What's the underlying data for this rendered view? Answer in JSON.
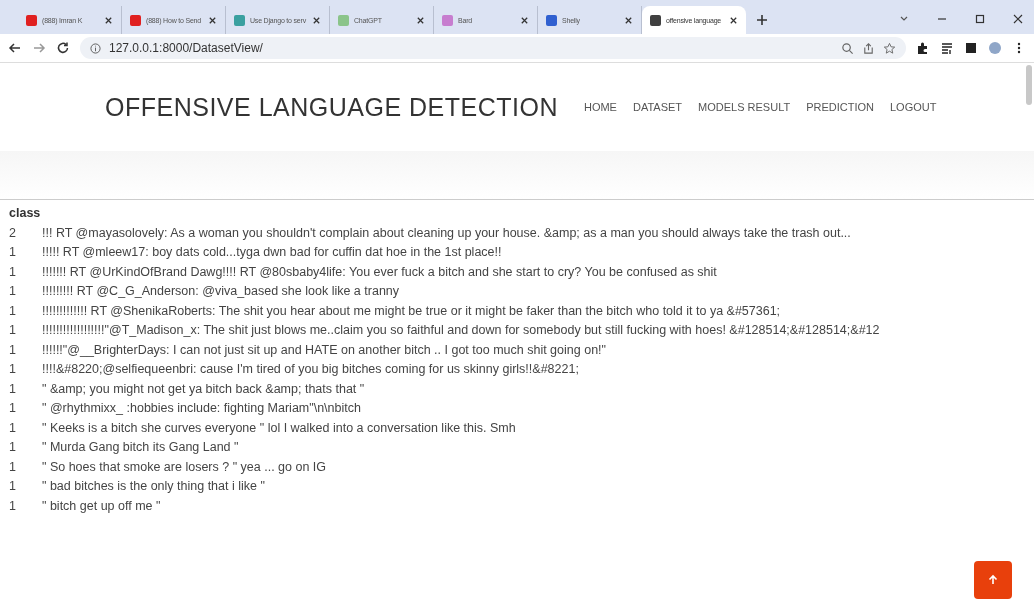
{
  "browser": {
    "tabs": [
      {
        "title": "(888) Imran K",
        "selected": false,
        "color": "#e02020"
      },
      {
        "title": "(888) How to Send",
        "selected": false,
        "color": "#e02020"
      },
      {
        "title": "Use Django to serv",
        "selected": false,
        "color": "#3aa0a0"
      },
      {
        "title": "ChatGPT",
        "selected": false,
        "color": "#8bc48a"
      },
      {
        "title": "Bard",
        "selected": false,
        "color": "#c77dcf"
      },
      {
        "title": "Shelly",
        "selected": false,
        "color": "#3060d0"
      },
      {
        "title": "offensive language",
        "selected": true,
        "color": "#404040"
      }
    ],
    "url": "127.0.0.1:8000/DatasetView/"
  },
  "site": {
    "title": "OFFENSIVE LANGUAGE DETECTION",
    "nav": [
      "HOME",
      "DATASET",
      "MODELS RESULT",
      "PREDICTION",
      "LOGOUT"
    ]
  },
  "table": {
    "header": "class",
    "rows": [
      {
        "class": "2",
        "tweet": "!!! RT @mayasolovely: As a woman you shouldn't complain about cleaning up your house. &amp; as a man you should always take the trash out..."
      },
      {
        "class": "1",
        "tweet": "!!!!! RT @mleew17: boy dats cold...tyga dwn bad for cuffin dat hoe in the 1st place!!"
      },
      {
        "class": "1",
        "tweet": "!!!!!!! RT @UrKindOfBrand Dawg!!!! RT @80sbaby4life: You ever fuck a bitch and she start to cry? You be confused as shit"
      },
      {
        "class": "1",
        "tweet": "!!!!!!!!! RT @C_G_Anderson: @viva_based she look like a tranny"
      },
      {
        "class": "1",
        "tweet": "!!!!!!!!!!!!! RT @ShenikaRoberts: The shit you hear about me might be true or it might be faker than the bitch who told it to ya &#57361;"
      },
      {
        "class": "1",
        "tweet": "!!!!!!!!!!!!!!!!!!\"@T_Madison_x: The shit just blows me..claim you so faithful and down for somebody but still fucking with hoes! &#128514;&#128514;&#12"
      },
      {
        "class": "1",
        "tweet": "!!!!!!\"@__BrighterDays: I can not just sit up and HATE on another bitch .. I got too much shit going on!\""
      },
      {
        "class": "1",
        "tweet": "!!!!&#8220;@selfiequeenbri: cause I'm tired of you big bitches coming for us skinny girls!!&#8221;"
      },
      {
        "class": "1",
        "tweet": "\" &amp; you might not get ya bitch back &amp; thats that \""
      },
      {
        "class": "1",
        "tweet": "\" @rhythmixx_ :hobbies include: fighting Mariam\"\\n\\nbitch"
      },
      {
        "class": "1",
        "tweet": "\" Keeks is a bitch she curves everyone \" lol I walked into a conversation like this. Smh"
      },
      {
        "class": "1",
        "tweet": "\" Murda Gang bitch its Gang Land \""
      },
      {
        "class": "1",
        "tweet": "\" So hoes that smoke are losers ? \" yea ... go on IG"
      },
      {
        "class": "1",
        "tweet": "\" bad bitches is the only thing that i like \""
      },
      {
        "class": "1",
        "tweet": "\" bitch get up off me \""
      }
    ]
  }
}
